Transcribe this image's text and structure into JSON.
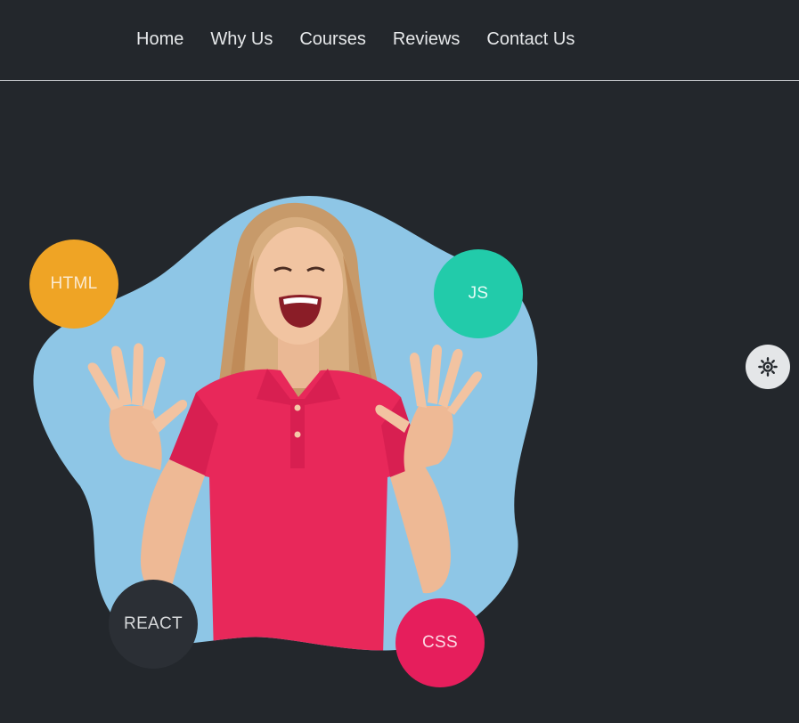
{
  "nav": {
    "items": [
      {
        "label": "Home"
      },
      {
        "label": "Why Us"
      },
      {
        "label": "Courses"
      },
      {
        "label": "Reviews"
      },
      {
        "label": "Contact Us"
      }
    ]
  },
  "hero": {
    "image_description_icon": "smiling-woman-illustration",
    "bubbles": {
      "html": "HTML",
      "js": "JS",
      "react": "REACT",
      "css": "CSS"
    }
  },
  "theme_toggle": {
    "icon": "sun-icon"
  },
  "colors": {
    "background": "#23272c",
    "blob": "#8ec6e6",
    "html_bubble": "#efa425",
    "js_bubble": "#22cbaa",
    "react_bubble": "#2b2f35",
    "css_bubble": "#e61e5c",
    "shirt": "#e8285a",
    "toggle": "#e4e6e8"
  }
}
